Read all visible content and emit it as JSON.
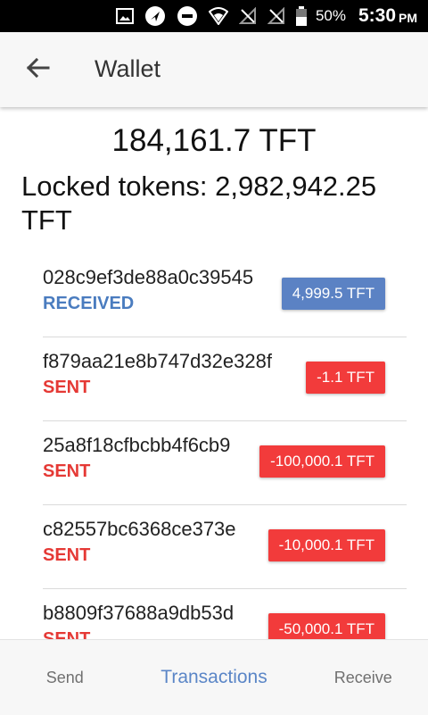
{
  "status_bar": {
    "battery": "50%",
    "time": "5:30",
    "ampm": "PM",
    "icons": [
      "image-icon",
      "navigation-icon",
      "do-not-disturb-icon",
      "wifi-icon",
      "no-signal-icon",
      "no-signal-icon",
      "battery-icon"
    ]
  },
  "header": {
    "title": "Wallet"
  },
  "wallet": {
    "balance": "184,161.7 TFT",
    "locked": "Locked tokens: 2,982,942.25 TFT"
  },
  "transactions": [
    {
      "hash": "028c9ef3de88a0c39545",
      "status": "RECEIVED",
      "amount": "4,999.5 TFT",
      "type": "received"
    },
    {
      "hash": "f879aa21e8b747d32e328f",
      "status": "SENT",
      "amount": "-1.1 TFT",
      "type": "sent"
    },
    {
      "hash": "25a8f18cfbcbb4f6cb9",
      "status": "SENT",
      "amount": "-100,000.1 TFT",
      "type": "sent"
    },
    {
      "hash": "c82557bc6368ce373e",
      "status": "SENT",
      "amount": "-10,000.1 TFT",
      "type": "sent"
    },
    {
      "hash": "b8809f37688a9db53d",
      "status": "SENT",
      "amount": "-50,000.1 TFT",
      "type": "sent"
    }
  ],
  "bottom_nav": {
    "send": "Send",
    "transactions": "Transactions",
    "receive": "Receive"
  },
  "colors": {
    "accent": "#5b86c7",
    "received": "#4a7cbf",
    "sent": "#e53935"
  }
}
